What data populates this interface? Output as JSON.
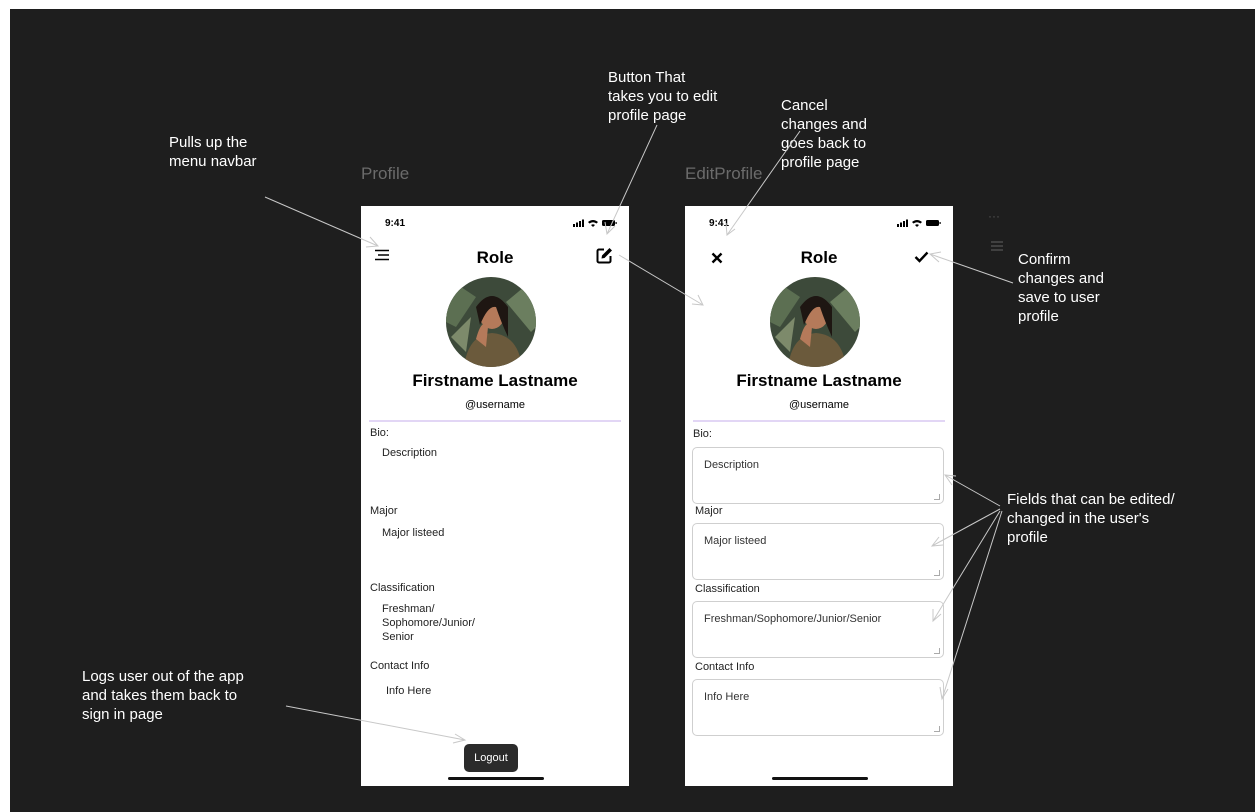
{
  "frames": {
    "profile_title": "Profile",
    "edit_profile_title": "EditProfile"
  },
  "profile": {
    "status_time": "9:41",
    "role": "Role",
    "fullname": "Firstname Lastname",
    "username": "@username",
    "bio_label": "Bio:",
    "bio_value": "Description",
    "major_label": "Major",
    "major_value": "Major listeed",
    "classification_label": "Classification",
    "classification_value": "Freshman/\nSophomore/Junior/\nSenior",
    "contact_label": "Contact Info",
    "contact_value": "Info Here",
    "logout_label": "Logout",
    "menu_icon": "hamburger-menu-icon",
    "edit_icon": "edit-icon"
  },
  "edit_profile": {
    "status_time": "9:41",
    "role": "Role",
    "fullname": "Firstname Lastname",
    "username": "@username",
    "bio_label": "Bio:",
    "bio_value": "Description",
    "major_label": "Major",
    "major_value": "Major listeed",
    "classification_label": "Classification",
    "classification_value": "Freshman/Sophomore/Junior/Senior",
    "contact_label": "Contact Info",
    "contact_value": "Info Here",
    "cancel_icon": "close-icon",
    "confirm_icon": "checkmark-icon"
  },
  "annotations": {
    "menu": "Pulls up the\nmenu navbar",
    "edit": "Button That\ntakes you to edit\nprofile page",
    "cancel": "Cancel\nchanges and\ngoes back to\nprofile page",
    "confirm": "Confirm\nchanges and\nsave to user\nprofile",
    "fields": "Fields that can be edited/\nchanged in the user's\nprofile",
    "logout": "Logs user out of the app\nand takes them back to\nsign in page"
  },
  "colors": {
    "canvas": "#1e1e1e",
    "divider": "#e2d6f5",
    "logout_button": "#2b2b2b"
  }
}
